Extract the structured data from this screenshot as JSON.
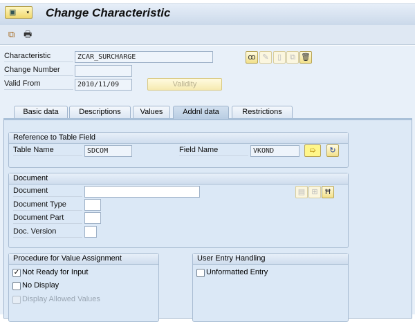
{
  "window": {
    "title": "Change Characteristic"
  },
  "toolbar": {
    "icons": [
      "other-object-icon",
      "print-icon"
    ]
  },
  "header": {
    "characteristic_label": "Characteristic",
    "characteristic_value": "ZCAR_SURCHARGE",
    "change_number_label": "Change Number",
    "change_number_value": "",
    "valid_from_label": "Valid From",
    "valid_from_value": "2010/11/09",
    "validity_button": "Validity"
  },
  "tabs": [
    {
      "label": "Basic data"
    },
    {
      "label": "Descriptions"
    },
    {
      "label": "Values"
    },
    {
      "label": "Addnl data",
      "active": true
    },
    {
      "label": "Restrictions"
    }
  ],
  "reference": {
    "title": "Reference to Table Field",
    "table_name_label": "Table Name",
    "table_name_value": "SDCOM",
    "field_name_label": "Field Name",
    "field_name_value": "VKOND"
  },
  "document": {
    "title": "Document",
    "document_label": "Document",
    "document_value": "",
    "doc_type_label": "Document Type",
    "doc_part_label": "Document Part",
    "doc_version_label": "Doc. Version"
  },
  "procedure": {
    "title": "Procedure for Value Assignment",
    "options": [
      {
        "label": "Not Ready for Input",
        "checked": true
      },
      {
        "label": "No Display",
        "checked": false
      },
      {
        "label": "Display Allowed Values",
        "checked": false,
        "disabled": true
      }
    ]
  },
  "user_entry": {
    "title": "User Entry Handling",
    "options": [
      {
        "label": "Unformatted Entry",
        "checked": false
      }
    ]
  }
}
